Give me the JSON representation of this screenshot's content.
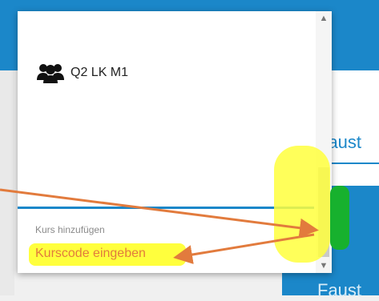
{
  "background": {
    "right_tab_text": "Faust",
    "right_button_text": "Faust"
  },
  "dropdown": {
    "course": {
      "icon": "group-icon",
      "label": "Q2 LK M1"
    },
    "add_course": {
      "label": "Kurs hinzufügen",
      "placeholder": "Kurscode eingeben"
    },
    "scrollbar": {
      "up_icon": "chevron-up-icon",
      "down_icon": "chevron-down-icon"
    }
  },
  "colors": {
    "accent": "#1b87c9",
    "annotation_yellow": "#ffff3d",
    "annotation_orange": "#e27b3d",
    "annotation_green": "#17b12e"
  }
}
